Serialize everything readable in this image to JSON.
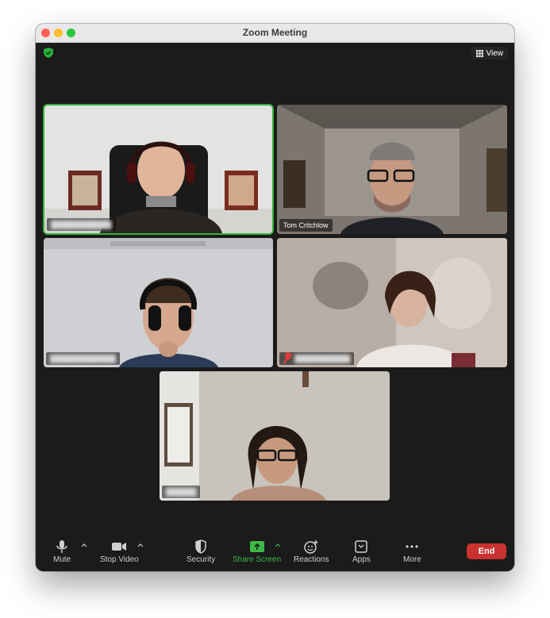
{
  "window": {
    "title": "Zoom Meeting"
  },
  "header": {
    "view_label": "View"
  },
  "participants": [
    {
      "name": "",
      "speaking": true
    },
    {
      "name": "Tom Critchlow",
      "speaking": false
    },
    {
      "name": "",
      "speaking": false
    },
    {
      "name": "",
      "speaking": false,
      "muted": true
    },
    {
      "name": "",
      "speaking": false
    }
  ],
  "toolbar": {
    "mute_label": "Mute",
    "stop_video_label": "Stop Video",
    "security_label": "Security",
    "share_screen_label": "Share Screen",
    "reactions_label": "Reactions",
    "apps_label": "Apps",
    "more_label": "More",
    "end_label": "End"
  },
  "colors": {
    "active_speaker_border": "#34b23a",
    "share_screen": "#3fb84a",
    "end_button": "#c9322e",
    "background": "#1b1b1b"
  }
}
